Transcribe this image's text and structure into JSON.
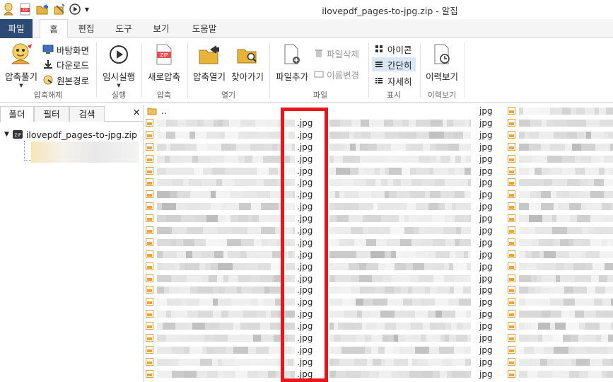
{
  "window": {
    "title": "ilovepdf_pages-to-jpg.zip - 알집",
    "quick_access": [
      "user-icon",
      "zip-icon",
      "open-folder-icon",
      "tools-icon",
      "play-icon",
      "dropdown-icon"
    ]
  },
  "tabs": {
    "file": "파일",
    "items": [
      "홈",
      "편집",
      "도구",
      "보기",
      "도움말"
    ],
    "active_index": 0
  },
  "ribbon": {
    "extract": {
      "main": "압축풀기",
      "desktop": "바탕화면",
      "download": "다운로드",
      "original": "원본경로",
      "group": "압축해제"
    },
    "run": {
      "main": "임시실행",
      "group": "실행"
    },
    "compress": {
      "main": "새로압축",
      "group": "압축"
    },
    "open": {
      "open_archive": "압축열기",
      "browse": "찾아가기",
      "group": "열기"
    },
    "file": {
      "add": "파일추가",
      "delete": "파일삭제",
      "rename": "이름변경",
      "group": "파일"
    },
    "view": {
      "icon": "아이콘",
      "simple": "간단히",
      "detail": "자세히",
      "group": "표시",
      "selected": "simple"
    },
    "history": {
      "main": "이력보기",
      "group": "이력보기"
    }
  },
  "left_panel": {
    "tabs": [
      "폴더",
      "필터",
      "검색"
    ],
    "close": "×",
    "tree_root": "ilovepdf_pages-to-jpg.zip"
  },
  "files": {
    "parent": "..",
    "extension": ".jpg",
    "extension_plain": "jpg",
    "col_c_count": 22,
    "col_d_count": 23
  },
  "colors": {
    "file_tab": "#2c4a73",
    "highlight_box": "#e8161b",
    "view_selected": "#d8e6f5",
    "jpg_icon": "#f0a23a"
  }
}
